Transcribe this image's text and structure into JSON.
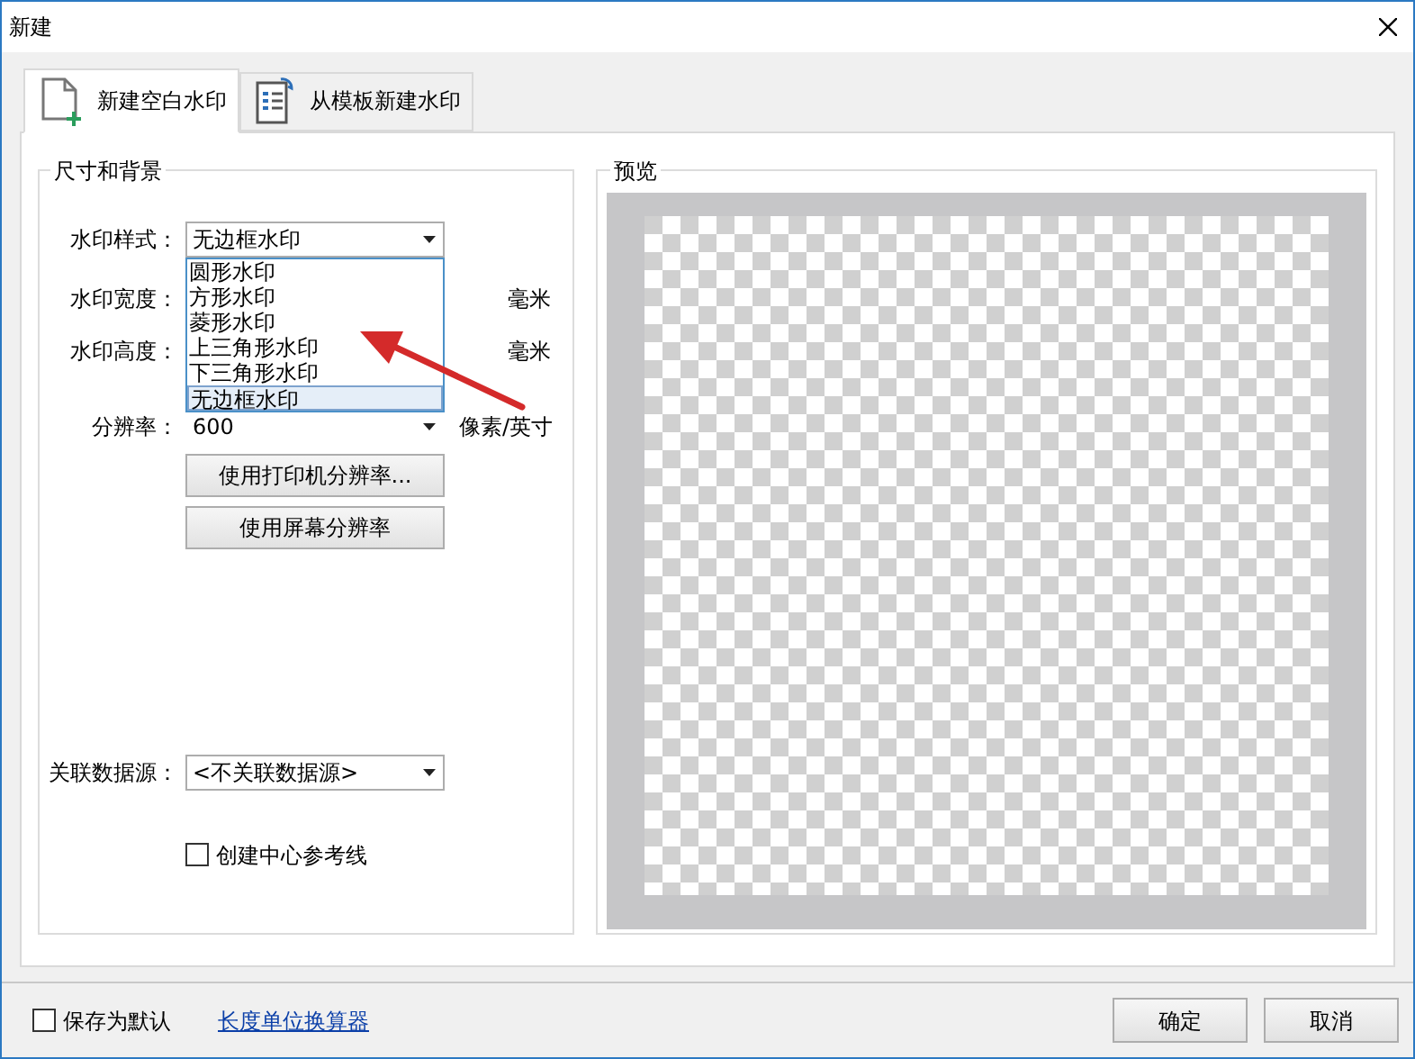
{
  "window": {
    "title": "新建"
  },
  "tabs": [
    {
      "label": "新建空白水印",
      "selected": true
    },
    {
      "label": "从模板新建水印",
      "selected": false
    }
  ],
  "size_group": {
    "title": "尺寸和背景",
    "style": {
      "label": "水印样式：",
      "value": "无边框水印",
      "expanded": true,
      "options": [
        {
          "label": "圆形水印",
          "selected": false
        },
        {
          "label": "方形水印",
          "selected": false
        },
        {
          "label": "菱形水印",
          "selected": false
        },
        {
          "label": "上三角形水印",
          "selected": false
        },
        {
          "label": "下三角形水印",
          "selected": false
        },
        {
          "label": "无边框水印",
          "selected": true
        }
      ]
    },
    "width": {
      "label": "水印宽度：",
      "unit": "毫米"
    },
    "height": {
      "label": "水印高度：",
      "unit": "毫米"
    },
    "resolution": {
      "label": "分辨率：",
      "value": "600",
      "unit": "像素/英寸"
    },
    "buttons": [
      "使用打印机分辨率...",
      "使用屏幕分辨率"
    ],
    "data_source": {
      "label": "关联数据源：",
      "value": "<不关联数据源>"
    },
    "center_lines": {
      "label": "创建中心参考线",
      "checked": false
    }
  },
  "preview": {
    "title": "预览"
  },
  "footer": {
    "save_default": {
      "label": "保存为默认",
      "checked": false
    },
    "link": "长度单位换算器",
    "buttons": [
      "确定",
      "取消"
    ]
  }
}
